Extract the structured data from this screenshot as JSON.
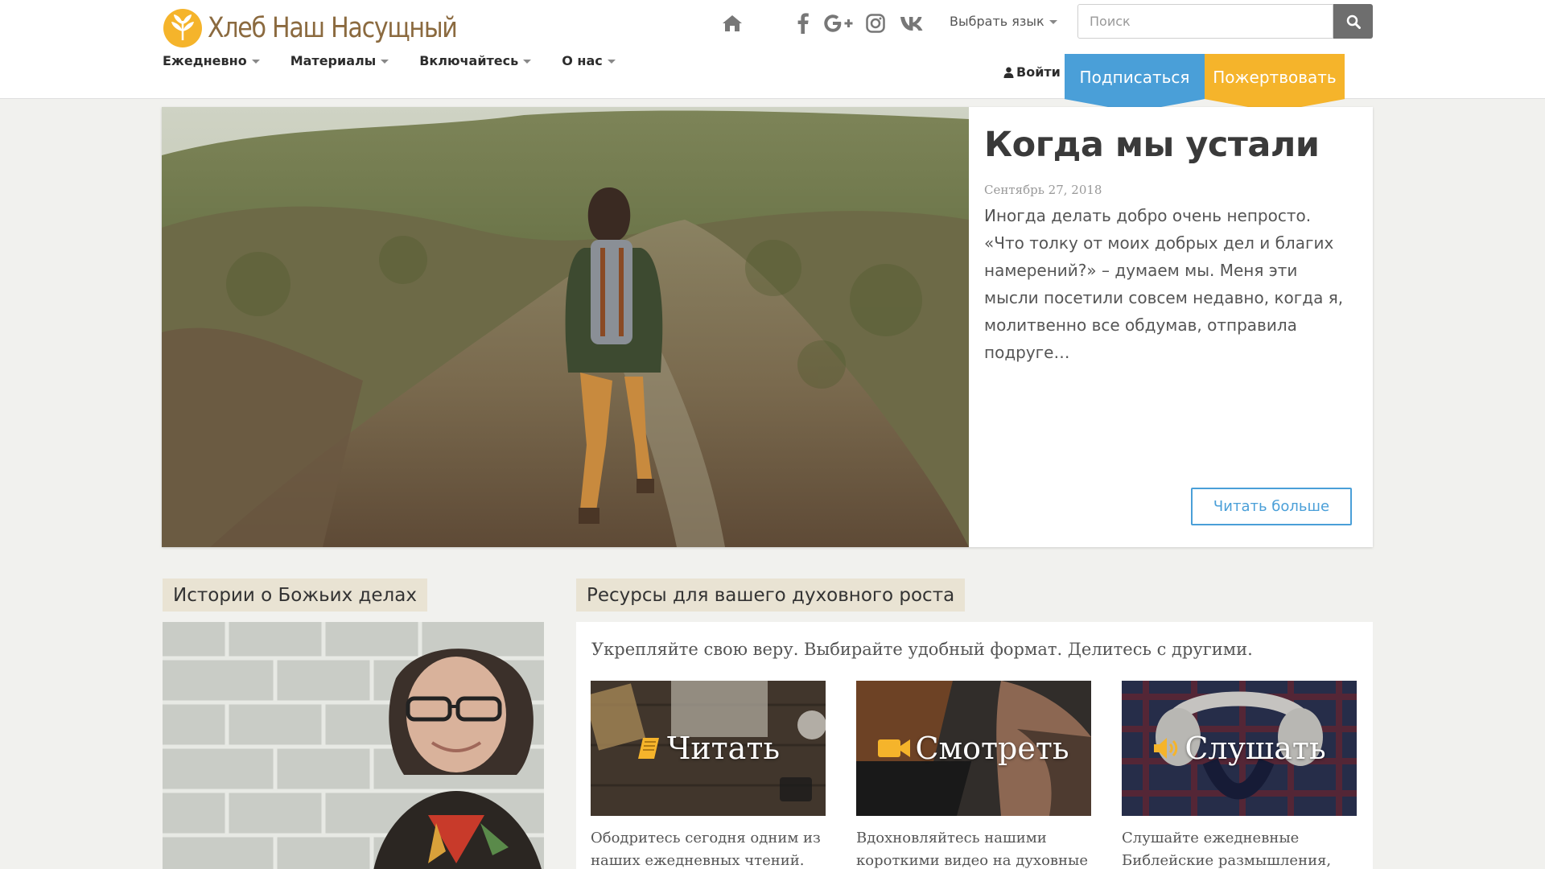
{
  "header": {
    "logo_text": "Хлеб Наш Насущный",
    "nav": [
      "Ежедневно",
      "Материалы",
      "Включайтесь",
      "О нас"
    ],
    "icons": [
      "home-icon",
      "facebook-icon",
      "google-plus-icon",
      "instagram-icon",
      "vk-icon"
    ],
    "language_label": "Выбрать язык",
    "search_placeholder": "Поиск",
    "login_label": "Войти",
    "subscribe_label": "Подписаться",
    "donate_label": "Пожертвовать"
  },
  "hero": {
    "title": "Когда мы устали",
    "date": "Сентябрь 27, 2018",
    "excerpt": "Иногда делать добро очень непросто. «Что толку от моих добрых дел и благих намерений?» – думаем мы. Меня эти мысли посетили совсем недавно, когда я, молитвенно все обдумав, отправила подруге…",
    "read_more_label": "Читать больше"
  },
  "stories": {
    "heading": "Истории о Божьих делах"
  },
  "resources": {
    "heading": "Ресурсы для вашего духовного роста",
    "intro": "Укрепляйте свою веру. Выбирайте удобный формат. Делитесь с другими.",
    "tiles": [
      {
        "label": "Читать",
        "icon": "book-icon",
        "description": "Ободритесь сегодня одним из наших ежедневных чтений."
      },
      {
        "label": "Смотреть",
        "icon": "video-camera-icon",
        "description": "Вдохновляйтесь нашими короткими видео на духовные"
      },
      {
        "label": "Слушать",
        "icon": "speaker-icon",
        "description": "Слушайте ежедневные Библейские размышления,"
      }
    ]
  },
  "colors": {
    "accent_blue": "#4a9fd8",
    "accent_orange": "#f5b42b",
    "logo_brown": "#8b6a3f"
  }
}
